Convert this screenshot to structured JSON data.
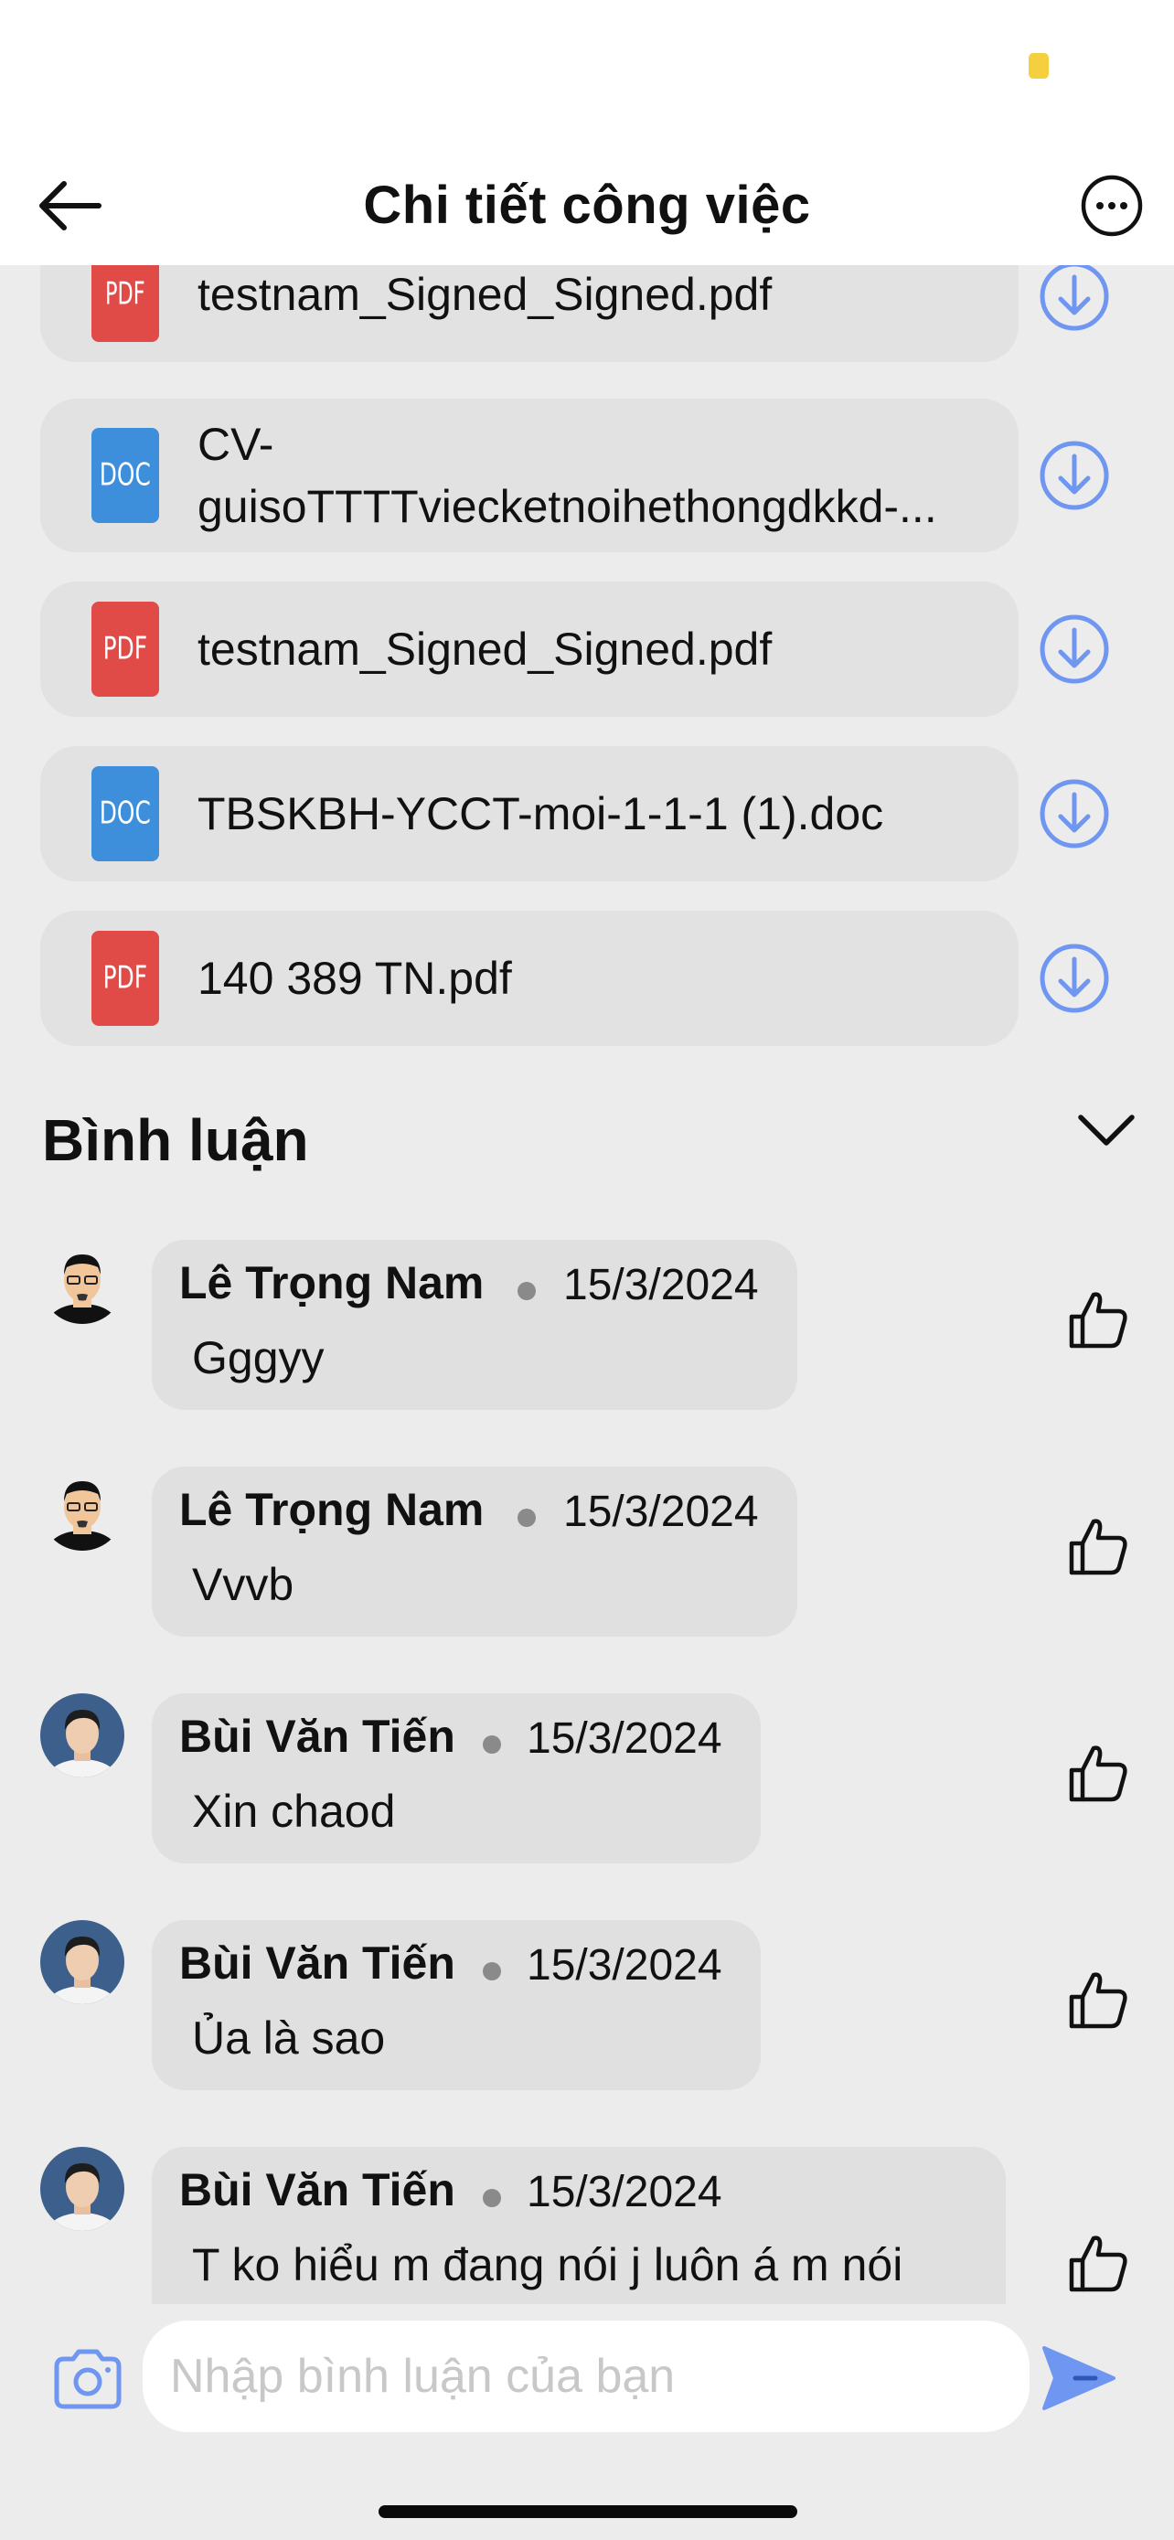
{
  "header": {
    "title": "Chi tiết công việc"
  },
  "attachments": [
    {
      "type": "PDF",
      "name": "testnam_Signed_Signed.pdf"
    },
    {
      "type": "DOC",
      "name_line1": "CV-",
      "name_line2": "guisoTTTTviecketnoihethongdkkd-..."
    },
    {
      "type": "PDF",
      "name": "testnam_Signed_Signed.pdf"
    },
    {
      "type": "DOC",
      "name": "TBSKBH-YCCT-moi-1-1-1 (1).doc"
    },
    {
      "type": "PDF",
      "name": "140 389 TN.pdf"
    }
  ],
  "comments_section": {
    "title": "Bình luận"
  },
  "comments": [
    {
      "author": "Lê Trọng Nam",
      "date": "15/3/2024",
      "text": "Gggyy"
    },
    {
      "author": "Lê Trọng Nam",
      "date": "15/3/2024",
      "text": "Vvvb"
    },
    {
      "author": "Bùi Văn Tiến",
      "date": "15/3/2024",
      "text": "Xin chaod"
    },
    {
      "author": "Bùi Văn Tiến",
      "date": "15/3/2024",
      "text": "Ủa là sao"
    },
    {
      "author": "Bùi Văn Tiến",
      "date": "15/3/2024",
      "text": "T ko hiểu m đang nói j luôn á m nói"
    }
  ],
  "composer": {
    "placeholder": "Nhập bình luận của bạn"
  },
  "colors": {
    "accent": "#6f96f0",
    "pdf": "#e04b48",
    "doc": "#3d8fdc",
    "status_indicator": "#f4d03f"
  }
}
